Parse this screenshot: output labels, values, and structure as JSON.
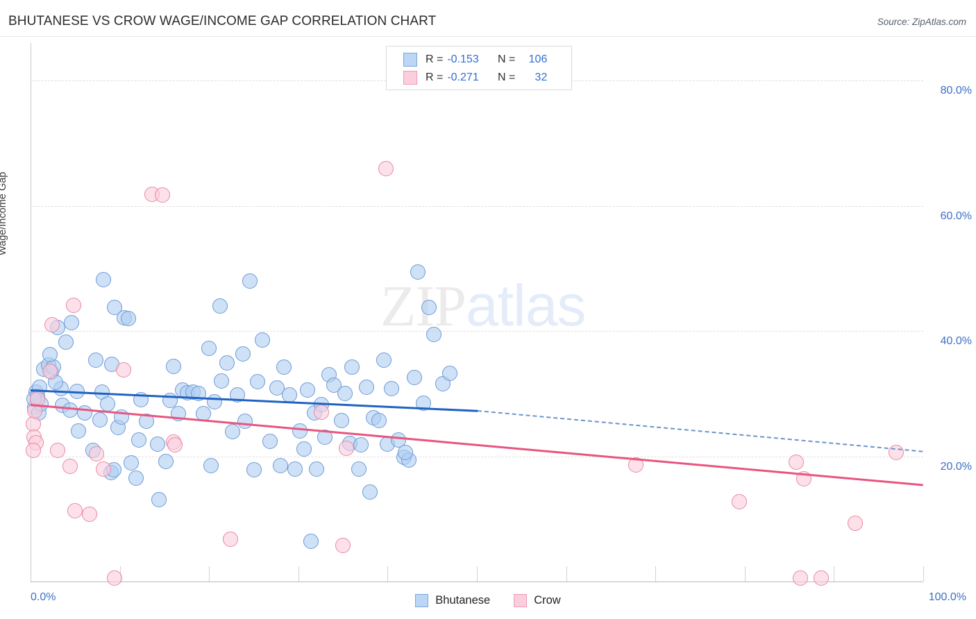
{
  "header": {
    "title": "BHUTANESE VS CROW WAGE/INCOME GAP CORRELATION CHART",
    "source": "Source: ZipAtlas.com"
  },
  "watermark": {
    "part1": "ZIP",
    "part2": "atlas"
  },
  "stats": {
    "bhutanese": {
      "r_label": "R =",
      "r_value": "-0.153",
      "n_label": "N =",
      "n_value": "106"
    },
    "crow": {
      "r_label": "R =",
      "r_value": "-0.271",
      "n_label": "N =",
      "n_value": "32"
    }
  },
  "series_legend": {
    "bhutanese": "Bhutanese",
    "crow": "Crow"
  },
  "chart_data": {
    "type": "scatter",
    "title": "BHUTANESE VS CROW WAGE/INCOME GAP CORRELATION CHART",
    "xlabel": "",
    "ylabel": "Wage/Income Gap",
    "xlim": [
      0,
      100
    ],
    "ylim": [
      0,
      86
    ],
    "grid": true,
    "x_ticks": [
      0,
      10,
      20,
      30,
      40,
      50,
      60,
      70,
      80,
      90,
      100
    ],
    "x_tick_labels": [
      "0.0%",
      "100.0%"
    ],
    "y_ticks": [
      20,
      40,
      60,
      80
    ],
    "y_tick_labels": [
      "20.0%",
      "40.0%",
      "60.0%",
      "80.0%"
    ],
    "legend_position": "bottom-center",
    "colors": {
      "bhutanese": "#b0cff2",
      "crow": "#fbcedd",
      "bhutanese_line": "#1f62c4",
      "crow_line": "#e8557f",
      "tick_text": "#3b6fc4"
    },
    "series": [
      {
        "name": "Bhutanese",
        "color": "#b0cff2",
        "r": -0.153,
        "n": 106,
        "trendline": {
          "x0": 0,
          "y0": 30.7,
          "x1": 50.1,
          "y1": 27.4,
          "style": "solid"
        },
        "trendline_extrapolated": {
          "x0": 50.1,
          "y0": 27.4,
          "x1": 100,
          "y1": 20.9,
          "style": "dashed"
        },
        "points": [
          [
            0.6,
            30.2
          ],
          [
            0.8,
            29.6
          ],
          [
            1.0,
            31.0
          ],
          [
            0.5,
            27.8
          ],
          [
            0.9,
            26.9
          ],
          [
            1.2,
            28.4
          ],
          [
            0.4,
            29.2
          ],
          [
            1.5,
            33.9
          ],
          [
            2.0,
            34.6
          ],
          [
            2.3,
            33.5
          ],
          [
            2.6,
            34.2
          ],
          [
            3.0,
            40.6
          ],
          [
            2.2,
            36.2
          ],
          [
            3.4,
            30.8
          ],
          [
            4.0,
            38.2
          ],
          [
            2.8,
            31.8
          ],
          [
            3.6,
            28.2
          ],
          [
            4.6,
            41.3
          ],
          [
            5.2,
            30.4
          ],
          [
            6.1,
            26.9
          ],
          [
            5.4,
            24.0
          ],
          [
            4.4,
            27.4
          ],
          [
            8.2,
            48.2
          ],
          [
            9.4,
            43.8
          ],
          [
            10.5,
            42.1
          ],
          [
            11.0,
            42.0
          ],
          [
            7.3,
            35.3
          ],
          [
            9.1,
            34.7
          ],
          [
            8.0,
            30.3
          ],
          [
            8.6,
            28.4
          ],
          [
            7.8,
            25.8
          ],
          [
            9.8,
            24.6
          ],
          [
            7.0,
            21.0
          ],
          [
            9.0,
            17.4
          ],
          [
            9.3,
            17.8
          ],
          [
            11.3,
            18.9
          ],
          [
            10.2,
            26.3
          ],
          [
            12.4,
            29.0
          ],
          [
            13.0,
            25.6
          ],
          [
            12.1,
            22.6
          ],
          [
            11.8,
            16.5
          ],
          [
            14.2,
            21.9
          ],
          [
            15.6,
            28.9
          ],
          [
            16.0,
            34.4
          ],
          [
            17.0,
            30.6
          ],
          [
            17.6,
            30.1
          ],
          [
            18.2,
            30.2
          ],
          [
            18.8,
            30.0
          ],
          [
            16.6,
            26.8
          ],
          [
            15.2,
            19.2
          ],
          [
            14.4,
            13.1
          ],
          [
            19.4,
            26.8
          ],
          [
            20.0,
            37.2
          ],
          [
            21.2,
            44.0
          ],
          [
            22.0,
            34.9
          ],
          [
            21.4,
            32.0
          ],
          [
            20.6,
            28.7
          ],
          [
            22.6,
            23.9
          ],
          [
            20.2,
            18.5
          ],
          [
            23.8,
            36.3
          ],
          [
            24.6,
            48.0
          ],
          [
            25.4,
            31.9
          ],
          [
            24.0,
            25.6
          ],
          [
            23.2,
            29.8
          ],
          [
            26.0,
            38.6
          ],
          [
            26.8,
            22.4
          ],
          [
            25.0,
            17.8
          ],
          [
            27.6,
            30.9
          ],
          [
            28.4,
            34.2
          ],
          [
            29.0,
            29.8
          ],
          [
            30.2,
            24.0
          ],
          [
            28.0,
            18.5
          ],
          [
            31.0,
            30.6
          ],
          [
            31.8,
            26.9
          ],
          [
            32.6,
            28.3
          ],
          [
            30.6,
            21.2
          ],
          [
            29.6,
            17.9
          ],
          [
            33.4,
            33.0
          ],
          [
            34.0,
            31.4
          ],
          [
            33.0,
            23.1
          ],
          [
            32.0,
            17.9
          ],
          [
            31.4,
            6.4
          ],
          [
            35.2,
            30.0
          ],
          [
            36.0,
            34.2
          ],
          [
            34.8,
            25.7
          ],
          [
            35.8,
            22.1
          ],
          [
            36.8,
            18.0
          ],
          [
            37.6,
            31.0
          ],
          [
            38.4,
            26.1
          ],
          [
            37.0,
            21.8
          ],
          [
            38.0,
            14.3
          ],
          [
            39.6,
            35.4
          ],
          [
            40.4,
            30.8
          ],
          [
            39.0,
            25.7
          ],
          [
            40.0,
            21.9
          ],
          [
            41.2,
            22.6
          ],
          [
            41.8,
            19.8
          ],
          [
            42.4,
            19.4
          ],
          [
            43.4,
            49.4
          ],
          [
            44.6,
            43.8
          ],
          [
            45.2,
            39.4
          ],
          [
            44.0,
            28.5
          ],
          [
            43.0,
            32.6
          ],
          [
            46.2,
            31.6
          ],
          [
            47.0,
            33.2
          ],
          [
            42.0,
            20.6
          ]
        ]
      },
      {
        "name": "Crow",
        "color": "#fbcedd",
        "r": -0.271,
        "n": 32,
        "trendline": {
          "x0": 0,
          "y0": 28.4,
          "x1": 100,
          "y1": 15.6,
          "style": "solid"
        },
        "points": [
          [
            0.3,
            25.2
          ],
          [
            0.5,
            27.3
          ],
          [
            0.4,
            23.0
          ],
          [
            0.6,
            22.2
          ],
          [
            0.3,
            20.9
          ],
          [
            0.8,
            29.1
          ],
          [
            2.4,
            41.0
          ],
          [
            2.2,
            33.6
          ],
          [
            4.8,
            44.1
          ],
          [
            3.0,
            20.9
          ],
          [
            4.4,
            18.4
          ],
          [
            5.0,
            11.3
          ],
          [
            6.6,
            10.7
          ],
          [
            7.4,
            20.4
          ],
          [
            8.2,
            17.9
          ],
          [
            10.4,
            33.8
          ],
          [
            13.6,
            61.8
          ],
          [
            14.8,
            61.7
          ],
          [
            16.0,
            22.3
          ],
          [
            16.2,
            21.8
          ],
          [
            9.4,
            0.6
          ],
          [
            22.4,
            6.8
          ],
          [
            32.6,
            27.0
          ],
          [
            35.4,
            21.3
          ],
          [
            35.0,
            5.8
          ],
          [
            39.8,
            65.9
          ],
          [
            67.8,
            18.6
          ],
          [
            79.4,
            12.8
          ],
          [
            85.8,
            19.1
          ],
          [
            86.6,
            16.4
          ],
          [
            92.4,
            9.3
          ],
          [
            86.2,
            0.5
          ],
          [
            88.6,
            0.5
          ],
          [
            97.0,
            20.6
          ]
        ]
      }
    ]
  }
}
